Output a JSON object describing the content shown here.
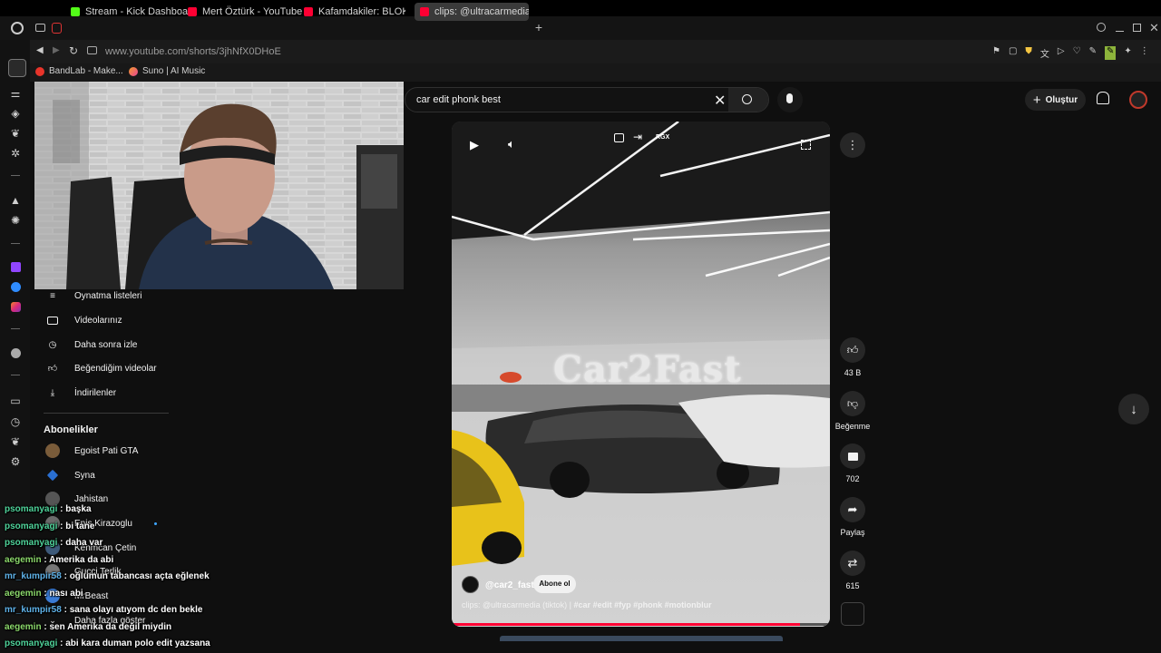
{
  "browser": {
    "tabs": [
      {
        "label": "Stream - Kick Dashboard",
        "favicon": "kick-icon"
      },
      {
        "label": "Mert Öztürk - YouTube",
        "favicon": "youtube-icon"
      },
      {
        "label": "Kafamdakiler: BLOK3 \"YA",
        "favicon": "youtube-icon"
      },
      {
        "label": "clips: @ultracarmedia (tik",
        "favicon": "youtube-icon"
      }
    ],
    "url": "www.youtube.com/shorts/3jhNfX0DHoE",
    "bookmarks": [
      {
        "label": "BandLab - Make...",
        "icon": "bandlab-icon"
      },
      {
        "label": "Suno | AI Music",
        "icon": "suno-icon"
      }
    ]
  },
  "youtube": {
    "search_query": "car edit phonk best",
    "create_label": "Oluştur",
    "nav_items": [
      {
        "label": "Oynatma listeleri",
        "icon": "playlist-icon"
      },
      {
        "label": "Videolarınız",
        "icon": "video-icon"
      },
      {
        "label": "Daha sonra izle",
        "icon": "clock-icon"
      },
      {
        "label": "Beğendiğim videolar",
        "icon": "thumb-up-icon"
      },
      {
        "label": "İndirilenler",
        "icon": "download-icon"
      }
    ],
    "subscriptions_title": "Abonelikler",
    "subscriptions": [
      {
        "label": "Egoist Pati GTA"
      },
      {
        "label": "Syna"
      },
      {
        "label": "Jahistan"
      },
      {
        "label": "Enis Kirazoglu"
      },
      {
        "label": "Kenmcan Çetin"
      },
      {
        "label": "Gucci Terlik"
      },
      {
        "label": "MrBeast"
      },
      {
        "label": "Daha fazla göster"
      }
    ],
    "short": {
      "overlay_text": "Car2Fast",
      "rgx_label": "RGX",
      "channel": "@car2_fast",
      "subscribe_label": "Abone ol",
      "caption_prefix": "clips: @ultracarmedia (tiktok) |",
      "hashtags": [
        "#car",
        "#edit",
        "#fyp",
        "#phonk",
        "#motionblur"
      ],
      "progress": 0.92
    },
    "actions": {
      "likes": "43 B",
      "dislike_label": "Beğenme",
      "comments": "702",
      "share_label": "Paylaş",
      "remix": "615"
    }
  },
  "chat": [
    {
      "user": "psomanyagi",
      "text": " : başka",
      "color": "u1"
    },
    {
      "user": "psomanyagi",
      "text": " : bi tane",
      "color": "u1"
    },
    {
      "user": "psomanyagi",
      "text": " : daha var",
      "color": "u1"
    },
    {
      "user": "aegemin",
      "text": " : Amerika da abi",
      "color": "u3"
    },
    {
      "user": "mr_kumpir58",
      "text": " : oğlumun tabancası açta eğlenek",
      "color": "u2"
    },
    {
      "user": "aegemin",
      "text": " : nası abi",
      "color": "u3"
    },
    {
      "user": "mr_kumpir58",
      "text": " : sana olayı atıyom dc den bekle",
      "color": "u2"
    },
    {
      "user": "aegemin",
      "text": " : sen Amerika da değil miydin",
      "color": "u3"
    },
    {
      "user": "psomanyagi",
      "text": " : abi kara duman polo edit yazsana",
      "color": "u1"
    }
  ],
  "colors": {
    "youtube_red": "#ff0033",
    "kick_green": "#53fc18",
    "background": "#0f0f0f"
  }
}
